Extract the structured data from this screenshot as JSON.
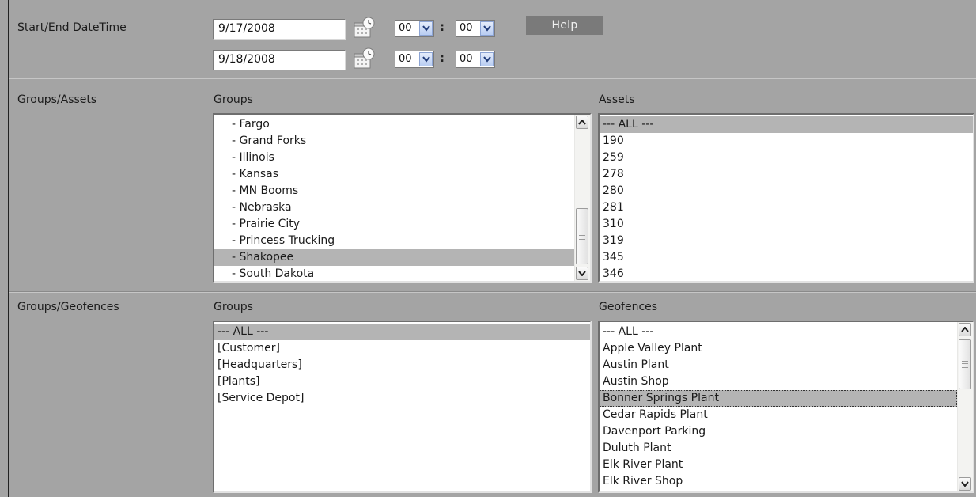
{
  "rows": {
    "datetime_label": "Start/End DateTime",
    "assets_label": "Groups/Assets",
    "geofences_label": "Groups/Geofences"
  },
  "datetime": {
    "start_date": "9/17/2008",
    "end_date": "9/18/2008",
    "start_hour": "00",
    "start_minute": "00",
    "end_hour": "00",
    "end_minute": "00",
    "separator": ":",
    "help_label": "Help"
  },
  "asset_groups": {
    "header": "Groups",
    "items": [
      "- Fargo",
      "- Grand Forks",
      "- Illinois",
      "- Kansas",
      "- MN Booms",
      "- Nebraska",
      "- Prairie City",
      "- Princess Trucking",
      "- Shakopee",
      "- South Dakota"
    ],
    "selected": "- Shakopee"
  },
  "assets": {
    "header": "Assets",
    "items": [
      "--- ALL ---",
      "190",
      "259",
      "278",
      "280",
      "281",
      "310",
      "319",
      "345",
      "346"
    ],
    "selected": "--- ALL ---"
  },
  "geofence_groups": {
    "header": "Groups",
    "items": [
      "--- ALL ---",
      "[Customer]",
      "[Headquarters]",
      "[Plants]",
      "[Service Depot]"
    ],
    "selected": "--- ALL ---"
  },
  "geofences": {
    "header": "Geofences",
    "items": [
      "--- ALL ---",
      "Apple Valley Plant",
      "Austin Plant",
      "Austin Shop",
      "Bonner Springs Plant",
      "Cedar Rapids Plant",
      "Davenport Parking",
      "Duluth Plant",
      "Elk River Plant",
      "Elk River Shop"
    ],
    "selected": "Bonner Springs Plant"
  },
  "icons": {
    "calendar": "calendar-clock-icon",
    "dropdown": "chevron-down-icon",
    "scroll_up": "scroll-up-arrow-icon",
    "scroll_down": "scroll-down-arrow-icon"
  },
  "colors": {
    "background": "#a4a4a4",
    "help_button": "#7a7a7a",
    "selection": "#b4b4b4"
  }
}
